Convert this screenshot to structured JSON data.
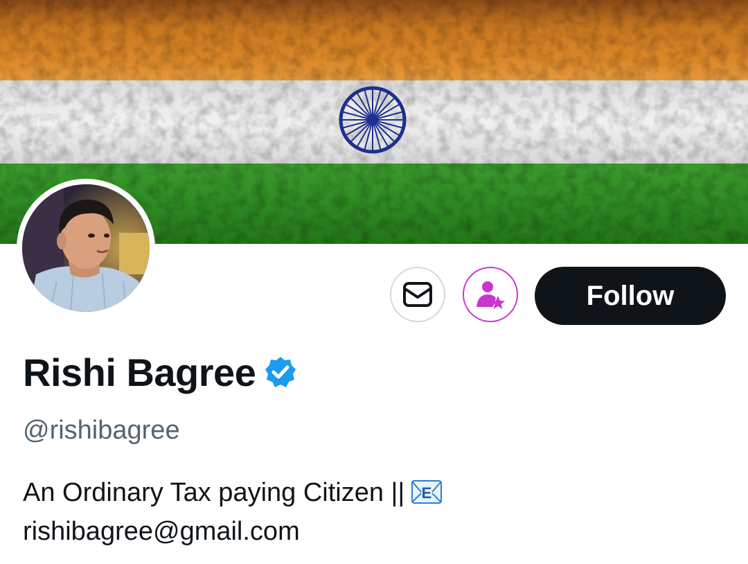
{
  "profile": {
    "name": "Rishi Bagree",
    "handle": "@rishibagree",
    "bio_line1": "An Ordinary Tax paying Citizen ||",
    "bio_line2": "rishibagree@gmail.com"
  },
  "actions": {
    "follow_label": "Follow"
  },
  "icons": {
    "message": "envelope-icon",
    "subscribe": "person-star-icon",
    "verified": "verified-badge-icon",
    "bio_emoji": "e-mail-envelope-icon"
  },
  "colors": {
    "saffron": "#d9771c",
    "white_band": "#ebebeb",
    "green": "#2f8a23",
    "chakra": "#1d2f8f",
    "follow_bg": "#0f1419",
    "subscribe_accent": "#c936cc",
    "verified_blue": "#1d9bf0",
    "handle_gray": "#536471"
  }
}
